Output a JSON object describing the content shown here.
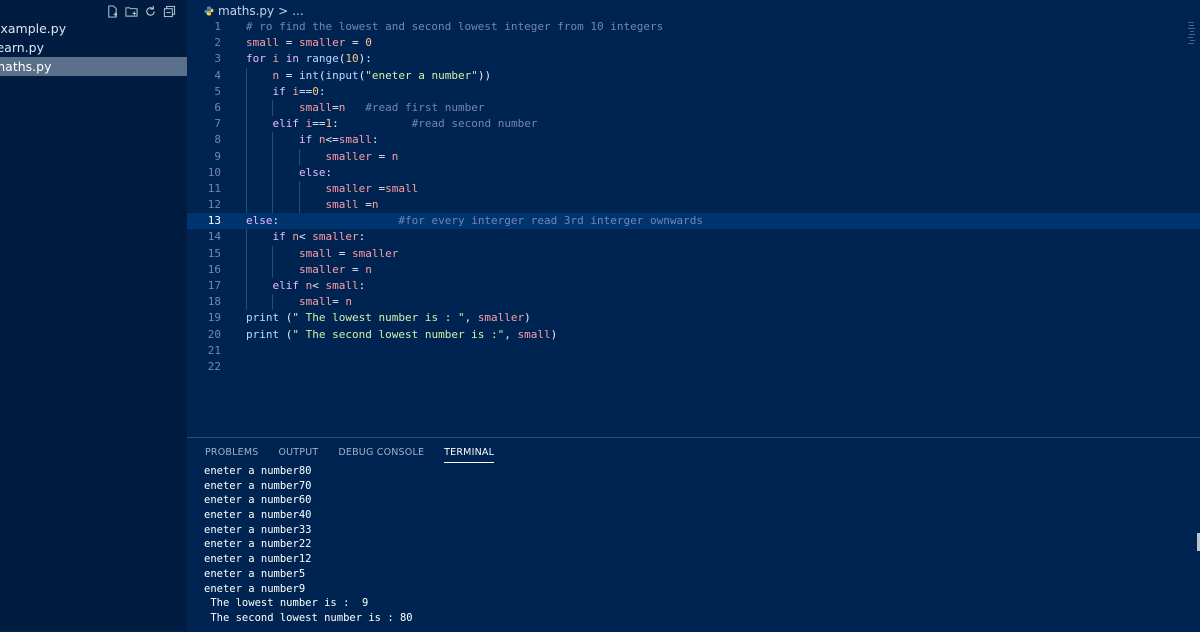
{
  "sidebar": {
    "files": [
      {
        "name": "example.py",
        "selected": false
      },
      {
        "name": "learn.py",
        "selected": false
      },
      {
        "name": "maths.py",
        "selected": true
      }
    ]
  },
  "breadcrumb": {
    "file": "maths.py",
    "separator": ">",
    "more": "..."
  },
  "editor": {
    "lines": [
      {
        "num": "1",
        "text": "# ro find the lowest and second lowest integer from 10 integers",
        "color": "#7285b7"
      },
      {
        "num": "2",
        "text": "small = smaller = 0"
      },
      {
        "num": "3",
        "text": "for i in range(10):"
      },
      {
        "num": "4",
        "text": "    n = int(input(\"eneter a number\"))"
      },
      {
        "num": "5",
        "text": "    if i==0:"
      },
      {
        "num": "6",
        "text": "        small=n   #read first number"
      },
      {
        "num": "7",
        "text": "    elif i==1:           #read second number"
      },
      {
        "num": "8",
        "text": "        if n<=small:"
      },
      {
        "num": "9",
        "text": "            smaller = n"
      },
      {
        "num": "10",
        "text": "        else:"
      },
      {
        "num": "11",
        "text": "            smaller =small"
      },
      {
        "num": "12",
        "text": "            small =n"
      },
      {
        "num": "13",
        "text": "else:                  #for every interger read 3rd interger ownwards",
        "highlight": true
      },
      {
        "num": "14",
        "text": "    if n< smaller:"
      },
      {
        "num": "15",
        "text": "        small = smaller"
      },
      {
        "num": "16",
        "text": "        smaller = n"
      },
      {
        "num": "17",
        "text": "    elif n< small:"
      },
      {
        "num": "18",
        "text": "        small= n"
      },
      {
        "num": "19",
        "text": "print (\" The lowest number is : \", smaller)"
      },
      {
        "num": "20",
        "text": "print (\" The second lowest number is :\", small)"
      },
      {
        "num": "21",
        "text": ""
      },
      {
        "num": "22",
        "text": ""
      }
    ]
  },
  "panel": {
    "tabs": [
      "PROBLEMS",
      "OUTPUT",
      "DEBUG CONSOLE",
      "TERMINAL"
    ],
    "active_tab": "TERMINAL",
    "terminal_lines": [
      "eneter a number80",
      "eneter a number70",
      "eneter a number60",
      "eneter a number40",
      "eneter a number33",
      "eneter a number22",
      "eneter a number12",
      "eneter a number5",
      "eneter a number9",
      " The lowest number is :  9",
      " The second lowest number is : 80"
    ]
  },
  "colors": {
    "background": "#002451",
    "sidebar": "#001c40",
    "selection": "#5a6f89",
    "line_highlight": "#00346e",
    "comment": "#7285b7",
    "keyword": "#ebbbff",
    "string": "#d1f1a9",
    "number": "#ffc58f",
    "function": "#bbdaff",
    "variable": "#ff9da4",
    "text": "#ffffff"
  },
  "icons": [
    "new-file-icon",
    "new-folder-icon",
    "refresh-icon",
    "collapse-all-icon",
    "python-file-icon"
  ]
}
